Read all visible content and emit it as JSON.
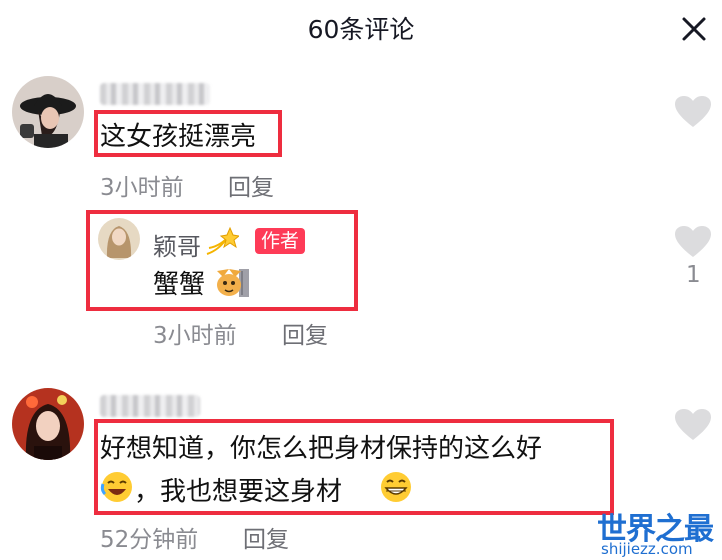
{
  "header": {
    "title": "60条评论"
  },
  "comments": [
    {
      "text": "这女孩挺漂亮",
      "time": "3小时前",
      "reply_label": "回复"
    },
    {
      "text_line1": "好想知道，你怎么把身材保持的这么好",
      "text_line2": "，我也想要这身材",
      "time": "52分钟前",
      "reply_label": "回复"
    }
  ],
  "reply": {
    "username": "颖哥",
    "badge": "作者",
    "text": "蟹蟹",
    "time": "3小时前",
    "reply_label": "回复",
    "likes": "1"
  },
  "watermark": {
    "main": "世界之最",
    "sub": "shijiezz.com"
  },
  "colors": {
    "highlight_box": "#ee2d3f",
    "author_badge": "#fe3b57",
    "watermark": "#1f6fd1"
  },
  "icons": [
    "close-icon",
    "heart-icon",
    "star-emoji",
    "cat-emoji",
    "laughing-emoji",
    "grinning-emoji"
  ]
}
